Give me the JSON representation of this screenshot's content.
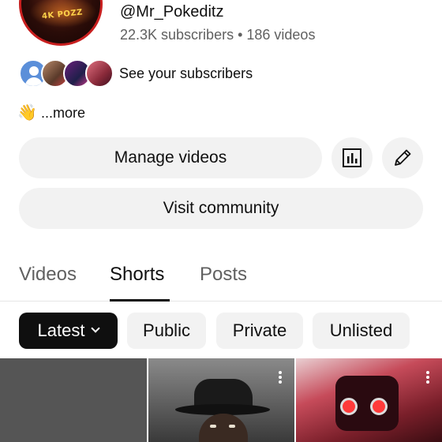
{
  "channel": {
    "handle": "@Mr_Pokeditz",
    "stats": "22.3K subscribers • 186 videos",
    "avatar_text": "4K POZZ"
  },
  "subscribers": {
    "label": "See your subscribers",
    "avatars": [
      "default-user-avatar",
      "subscriber-avatar",
      "subscriber-avatar",
      "subscriber-avatar"
    ]
  },
  "description": {
    "emoji": "👋",
    "more_label": "...more"
  },
  "actions": {
    "manage_videos": "Manage videos",
    "analytics_icon": "bar-chart-icon",
    "edit_icon": "pencil-icon",
    "visit_community": "Visit community"
  },
  "tabs": [
    {
      "label": "Videos",
      "selected": false
    },
    {
      "label": "Shorts",
      "selected": true
    },
    {
      "label": "Posts",
      "selected": false
    }
  ],
  "filters": [
    {
      "label": "Latest",
      "selected": true
    },
    {
      "label": "Public",
      "selected": false
    },
    {
      "label": "Private",
      "selected": false
    },
    {
      "label": "Unlisted",
      "selected": false
    }
  ],
  "shorts": [
    {
      "thumbnail": "gray-placeholder"
    },
    {
      "thumbnail": "man-in-fedora-hat"
    },
    {
      "thumbnail": "red-robot-speakerman"
    }
  ],
  "colors": {
    "text_primary": "#0f0f0f",
    "text_secondary": "#606060",
    "chip_bg": "#f2f2f2",
    "selected_chip_bg": "#0f0f0f",
    "avatar_ring": "#c81f1f"
  }
}
